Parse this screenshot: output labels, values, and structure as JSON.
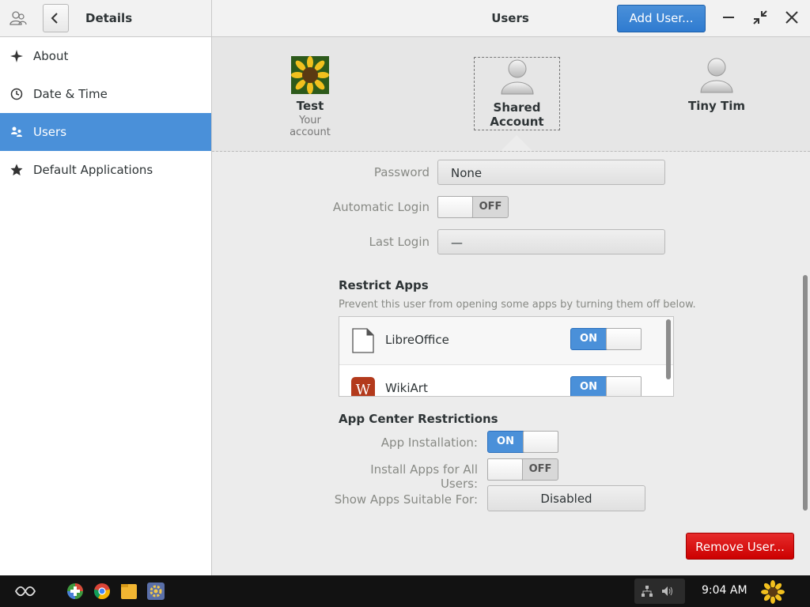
{
  "header": {
    "subtitle": "Details",
    "title": "Users",
    "add_user_label": "Add User..."
  },
  "sidebar": {
    "items": [
      {
        "label": "About",
        "icon": "star-outline-icon"
      },
      {
        "label": "Date & Time",
        "icon": "clock-icon"
      },
      {
        "label": "Users",
        "icon": "users-icon",
        "active": true
      },
      {
        "label": "Default Applications",
        "icon": "star-icon"
      }
    ]
  },
  "users": [
    {
      "name": "Test",
      "subtitle": "Your account",
      "avatar": "sunflower-avatar"
    },
    {
      "name": "Shared Account",
      "subtitle": "",
      "avatar": "default-avatar",
      "selected": true
    },
    {
      "name": "Tiny Tim",
      "subtitle": "",
      "avatar": "default-avatar"
    }
  ],
  "details": {
    "password_label": "Password",
    "password_value": "None",
    "auto_login_label": "Automatic Login",
    "auto_login_state": "OFF",
    "last_login_label": "Last Login",
    "last_login_value": "—"
  },
  "restrict_apps": {
    "title": "Restrict Apps",
    "description": "Prevent this user from opening some apps by turning them off below.",
    "apps": [
      {
        "name": "LibreOffice",
        "state": "ON",
        "icon": "document-icon"
      },
      {
        "name": "WikiArt",
        "state": "ON",
        "icon": "wikiart-icon"
      }
    ]
  },
  "app_center": {
    "title": "App Center Restrictions",
    "installation_label": "App Installation:",
    "installation_state": "ON",
    "install_all_label": "Install Apps for All Users:",
    "install_all_state": "OFF",
    "suitable_label": "Show Apps Suitable For:",
    "suitable_value": "Disabled"
  },
  "remove_user_label": "Remove User...",
  "taskbar": {
    "clock": "9:04 AM"
  },
  "colors": {
    "accent": "#4a90d9",
    "destructive": "#cc0000"
  }
}
